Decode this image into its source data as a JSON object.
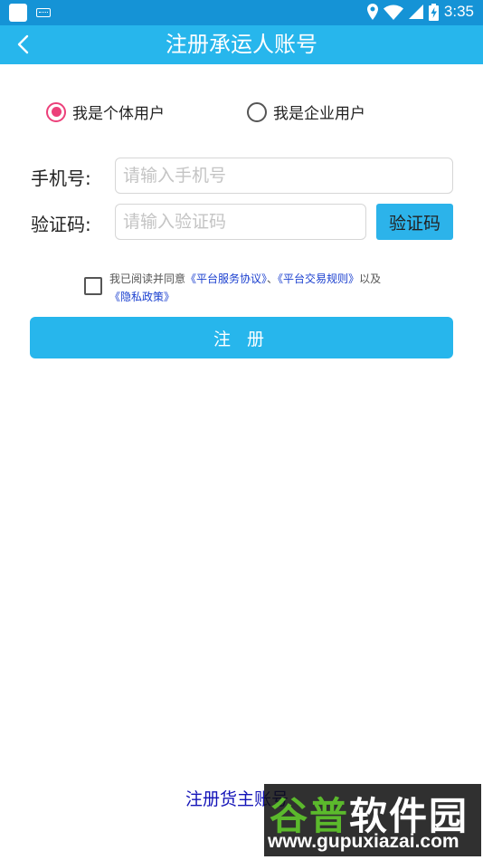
{
  "status_bar": {
    "time": "3:35"
  },
  "toolbar": {
    "back_icon": "chevron-left-icon",
    "title": "注册承运人账号"
  },
  "user_type": {
    "options": [
      {
        "label": "我是个体用户",
        "checked": true
      },
      {
        "label": "我是企业用户",
        "checked": false
      }
    ]
  },
  "form": {
    "phone_label": "手机号:",
    "phone_placeholder": "请输入手机号",
    "phone_value": "",
    "code_label": "验证码:",
    "code_placeholder": "请输入验证码",
    "code_value": "",
    "code_button": "验证码"
  },
  "agreement": {
    "checked": false,
    "prefix": "我已阅读并同意",
    "link_service": "《平台服务协议》",
    "sep": "、",
    "link_trade": "《平台交易规则》",
    "suffix": "以及",
    "link_privacy": "《隐私政策》"
  },
  "register_button": "注 册",
  "shipper_link": "注册货主账号",
  "watermark": {
    "top_green": "谷普",
    "top_white": "软件园",
    "url": "www.gupuxiazai.com"
  },
  "colors": {
    "status_bar": "#1593d6",
    "toolbar": "#27b6ec",
    "radio_checked": "#ec407a",
    "link": "#1a3fcf"
  }
}
